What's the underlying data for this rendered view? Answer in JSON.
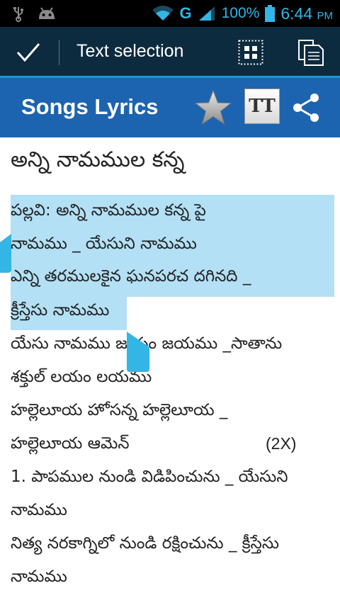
{
  "status_bar": {
    "battery": "100%",
    "time": "6:44",
    "ampm": "PM",
    "network": "G"
  },
  "action_bar": {
    "title": "Text selection"
  },
  "app_bar": {
    "title": "Songs Lyrics",
    "tt_label": "TT"
  },
  "song": {
    "title": "అన్ని నామముల కన్న",
    "lines": [
      {
        "text": "పల్లవి:      అన్ని నామముల కన్న పై",
        "note": ""
      },
      {
        "text": "నామము _ యేసుని  నామము",
        "note": ""
      },
      {
        "text": "ఎన్ని తరములకైన ఘనపరచ దగినది _",
        "note": ""
      },
      {
        "text": "క్రీస్తేసు నామము",
        "note": ""
      },
      {
        "text": "యేసు నామము జయం జయము _సాతాను",
        "note": ""
      },
      {
        "text": "శక్తుల్ లయం  లయము",
        "note": ""
      },
      {
        "text": "హల్లెలూయ హోసన్న హల్లెలూయ _",
        "note": ""
      },
      {
        "text": "హల్లెలూయ ఆమెన్",
        "note": "(2X)"
      },
      {
        "text": "1. పాపముల నుండి విడిపించును _ యేసుని",
        "note": ""
      },
      {
        "text": "నామము",
        "note": ""
      },
      {
        "text": "నిత్య నరకాగ్నిలో నుండి రక్షించును _ క్రీస్తేసు",
        "note": ""
      },
      {
        "text": "నామము",
        "note": ""
      }
    ]
  },
  "colors": {
    "status_bar_bg": "#000000",
    "status_icon": "#33b5e5",
    "action_bar_bg": "#0d2b3f",
    "app_bar_bg": "#1d64b0",
    "selection": "#b3e0f5",
    "handle": "#33b5e5"
  }
}
